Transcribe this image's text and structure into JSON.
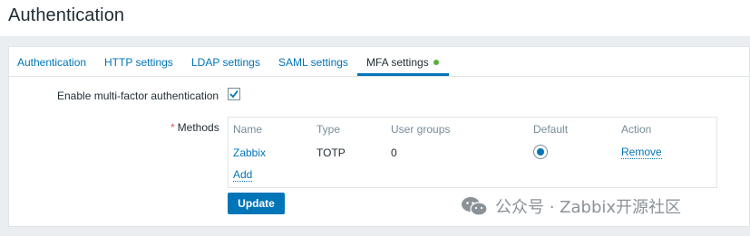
{
  "page_title": "Authentication",
  "tabs": [
    {
      "label": "Authentication"
    },
    {
      "label": "HTTP settings"
    },
    {
      "label": "LDAP settings"
    },
    {
      "label": "SAML settings"
    },
    {
      "label": "MFA settings",
      "active": true
    }
  ],
  "form": {
    "enable_label": "Enable multi-factor authentication",
    "enable_checked": true,
    "required_mark": "*",
    "methods_label": "Methods"
  },
  "methods_table": {
    "columns": [
      "Name",
      "Type",
      "User groups",
      "Default",
      "Action"
    ],
    "rows": [
      {
        "name": "Zabbix",
        "type": "TOTP",
        "user_groups": "0",
        "default": true,
        "action": "Remove"
      }
    ],
    "add_label": "Add"
  },
  "update_label": "Update",
  "watermark": {
    "text": "公众号 · Zabbix开源社区",
    "icon": "wechat-icon"
  },
  "colors": {
    "accent": "#0275b8",
    "status_ok": "#59af3d",
    "required": "#e45959",
    "background": "#ebeef0"
  }
}
